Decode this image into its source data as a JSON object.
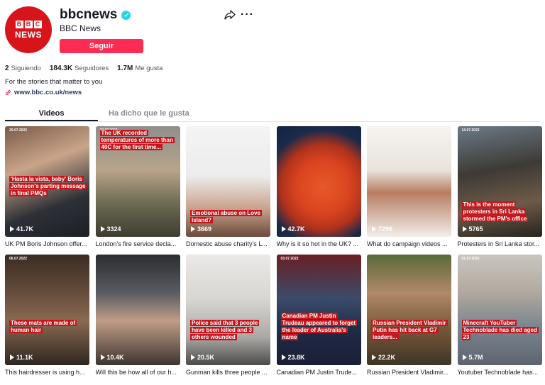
{
  "profile": {
    "avatar_top": "BBC",
    "avatar_letters": [
      "B",
      "B",
      "C"
    ],
    "avatar_bottom": "NEWS",
    "username": "bbcnews",
    "display_name": "BBC News",
    "follow_label": "Seguir",
    "stats": [
      {
        "value": "2",
        "label": "Siguiendo"
      },
      {
        "value": "184.3K",
        "label": "Seguidores"
      },
      {
        "value": "1.7M",
        "label": "Me gusta"
      }
    ],
    "bio": "For the stories that matter to you",
    "link": "www.bbc.co.uk/news",
    "icons": {
      "verified": "verified-icon",
      "share": "share-icon",
      "more": "more-icon",
      "link": "link-icon"
    },
    "accent_color": "#fe2c55"
  },
  "tabs": [
    {
      "label": "Videos",
      "active": true
    },
    {
      "label": "Ha dicho que le gusta",
      "active": false
    }
  ],
  "videos": [
    {
      "date": "20.07.2022",
      "caption": "'Hasta la vista, baby' Boris Johnson's parting message in final PMQs",
      "views": "41.7K",
      "title": "UK PM Boris Johnson offer..."
    },
    {
      "date": "19.07.2022",
      "caption": "The UK recorded temperatures of more than 40C for the first time...",
      "views": "3324",
      "title": "London's fire service decla..."
    },
    {
      "date": "",
      "caption": "Emotional abuse on Love Island?",
      "views": "3669",
      "title": "Domestic abuse charity's L..."
    },
    {
      "date": "",
      "caption": "",
      "views": "42.7K",
      "title": "Why is it so hot in the UK? ..."
    },
    {
      "date": "",
      "caption": "",
      "views": "7296",
      "title": "What do campaign videos ..."
    },
    {
      "date": "14.07.2022",
      "caption": "This is the moment protesters in Sri Lanka stormed the PM's office",
      "views": "5765",
      "title": "Protesters in Sri Lanka stor..."
    },
    {
      "date": "06.07.2022",
      "caption": "These mats are made of human hair",
      "views": "11.1K",
      "title": "This hairdresser is using h..."
    },
    {
      "date": "",
      "caption": "",
      "views": "10.4K",
      "title": "Will this be how all of our h..."
    },
    {
      "date": "",
      "caption": "Police said that 3 people have been killed and 3 others wounded",
      "views": "20.5K",
      "title": "Gunman kills three people ..."
    },
    {
      "date": "03.07.2022",
      "caption": "Canadian PM Justin Trudeau appeared to forget the leader of Australia's name",
      "views": "23.8K",
      "title": "Canadian PM Justin Trude..."
    },
    {
      "date": "",
      "caption": "Russian President Vladimir Putin has hit back at G7 leaders...",
      "views": "22.2K",
      "title": "Russian President Vladimir..."
    },
    {
      "date": "01.07.2022",
      "caption": "Minecraft YouTuber Technoblade has died aged 23",
      "views": "5.7M",
      "title": "Youtuber Technoblade has..."
    }
  ]
}
